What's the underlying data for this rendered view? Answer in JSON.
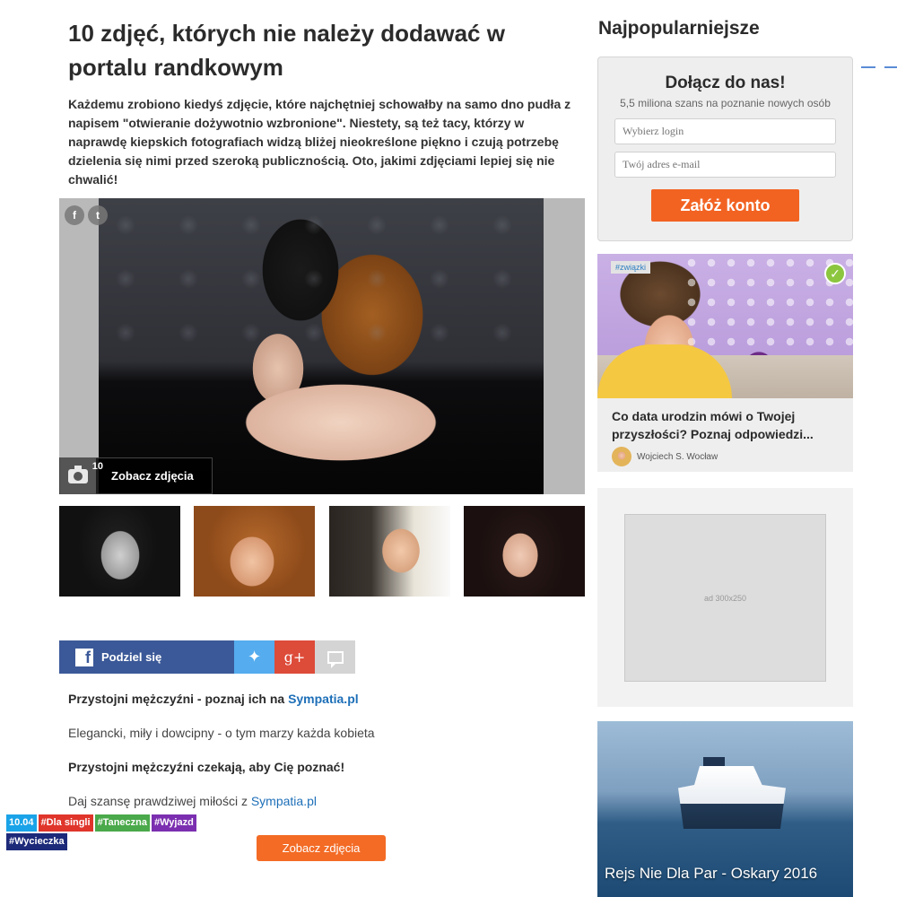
{
  "article": {
    "title": "10 zdjęć, których nie należy dodawać w portalu randkowym",
    "lead": "Każdemu zrobiono kiedyś zdjęcie, które najchętniej schowałby na samo dno pudła z napisem \"otwieranie dożywotnio wzbronione\". Niestety, są też tacy, którzy w naprawdę kiepskich fotografiach widzą bliżej nieokreślone piękno i czują potrzebę dzielenia się nimi przed szeroką publicznością. Oto, jakimi zdjęciami lepiej się nie chwalić!",
    "gallery": {
      "count": "10",
      "button_label": "Zobacz zdjęcia",
      "share_icons": [
        "facebook-icon",
        "twitter-icon"
      ]
    },
    "thumbnails": [
      "thumb-1",
      "thumb-2",
      "thumb-3",
      "thumb-4"
    ]
  },
  "sharebar": {
    "facebook_label": "Podziel się",
    "facebook_glyph": "f",
    "twitter_glyph": "🐦",
    "gplus_glyph": "g+"
  },
  "body": {
    "p1_text": "Przystojni mężczyźni - poznaj ich na ",
    "p1_link": "Sympatia.pl",
    "p2": "Elegancki, miły i dowcipny - o tym marzy każda kobieta",
    "p3": "Przystojni mężczyźni czekają, aby Cię poznać!",
    "p4_text": "Daj szansę prawdziwej miłości z ",
    "p4_link": "Sympatia.pl",
    "cta": "Zobacz zdjęcia"
  },
  "sidebar": {
    "title": "Najpopularniejsze",
    "join": {
      "heading": "Dołącz do nas!",
      "subheading": "5,5 miliona szans na poznanie nowych osób",
      "login_placeholder": "Wybierz login",
      "email_placeholder": "Twój adres e-mail",
      "button": "Załóż konto"
    },
    "article": {
      "tag": "#związki",
      "title": "Co data urodzin mówi o Twojej przyszłości? Poznaj odpowiedzi...",
      "author": "Wojciech S. Wocław"
    },
    "ad_label": "ad 300x250",
    "promo": {
      "tags": [
        {
          "text": "10.04",
          "style": "date"
        },
        {
          "text": "#Dla singli",
          "style": "red"
        },
        {
          "text": "#Taneczna",
          "style": "green"
        },
        {
          "text": "#Wyjazd",
          "style": "purple"
        },
        {
          "text": "#Wycieczka",
          "style": "navy"
        }
      ],
      "title": "Rejs Nie Dla Par - Oskary 2016"
    }
  },
  "colors": {
    "accent_orange": "#f26322",
    "facebook": "#3b5998",
    "twitter": "#55acee",
    "gplus": "#dd4b39",
    "link": "#1d6fb8"
  }
}
